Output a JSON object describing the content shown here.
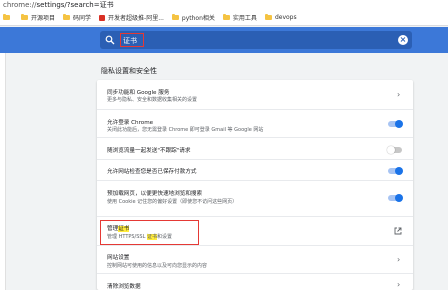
{
  "address": {
    "url_prefix": "chrome://",
    "url_path": "settings/?search=证书"
  },
  "bookmarks": [
    {
      "label": "",
      "icon": "folder-icon"
    },
    {
      "label": "开源项目",
      "icon": "folder-icon"
    },
    {
      "label": "码同学",
      "icon": "folder-icon"
    },
    {
      "label": "开发者超级推-阿里...",
      "icon": "red-favicon"
    },
    {
      "label": "python相关",
      "icon": "folder-icon"
    },
    {
      "label": "实用工具",
      "icon": "folder-icon"
    },
    {
      "label": "devops",
      "icon": "folder-icon"
    }
  ],
  "search": {
    "value": "证书"
  },
  "section": {
    "title": "隐私设置和安全性"
  },
  "rows": [
    {
      "title": "同步功能和 Google 服务",
      "desc": "更多与隐私、安全和数据收集相关的设置",
      "control": "arrow"
    },
    {
      "title": "允许登录 Chrome",
      "desc": "关闭此功能后，您无需登录 Chrome 即可登录 Gmail 等 Google 网站",
      "control": "toggle-on"
    },
    {
      "title": "随浏览流量一起发送\"不跟踪\"请求",
      "desc": "",
      "control": "toggle-off"
    },
    {
      "title": "允许网站检查您是否已保存付款方式",
      "desc": "",
      "control": "toggle-on"
    },
    {
      "title": "预加载网页，以便更快速地浏览和搜索",
      "desc": "使用 Cookie 记住您的偏好设置（即使您不访问这些网页）",
      "control": "toggle-on"
    },
    {
      "title_pre": "管理",
      "title_hl": "证书",
      "desc_pre": "管理 HTTPS/SSL ",
      "desc_hl": "证书",
      "desc_post": "和设置",
      "control": "external"
    },
    {
      "title": "网站设置",
      "desc": "控制网站可使用的信息以及可向您显示的内容",
      "control": "arrow"
    },
    {
      "title": "清除浏览数据",
      "desc": "",
      "control": "arrow"
    }
  ],
  "colors": {
    "header": "#3c78d8",
    "toggle_on": "#1a73e8",
    "highlight": "#ffeb3b",
    "outline": "#e53935"
  }
}
